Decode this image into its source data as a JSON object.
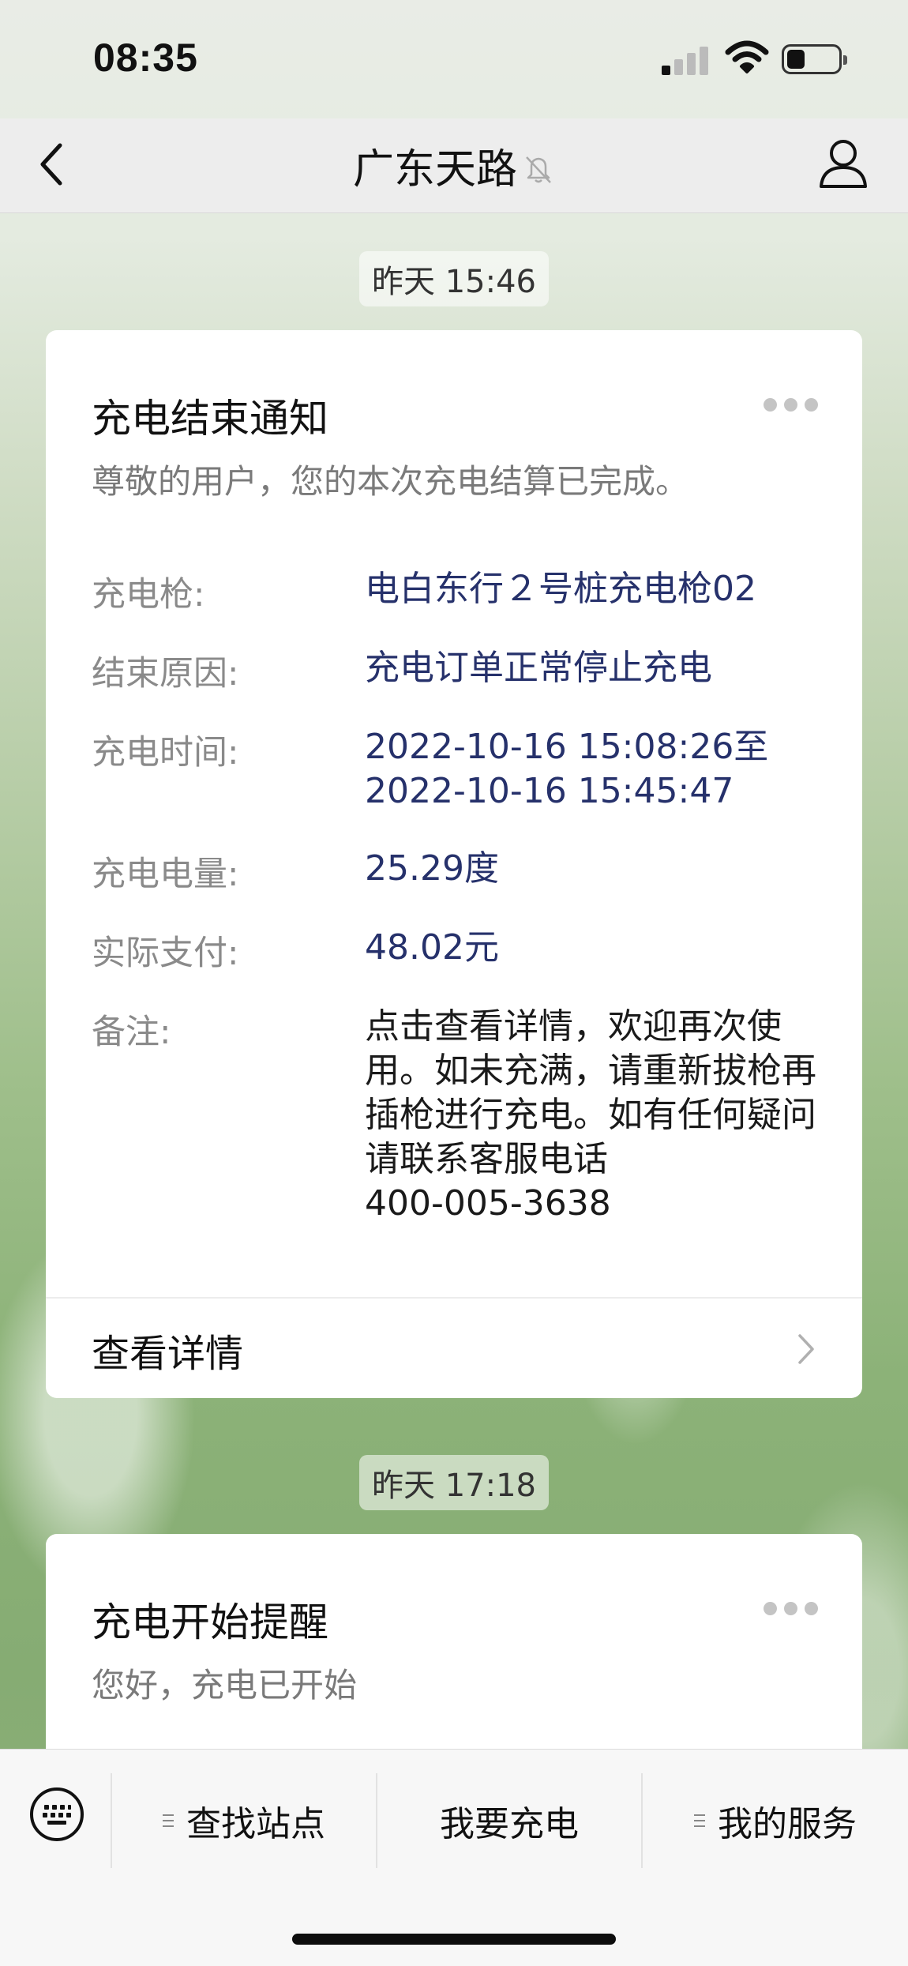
{
  "status_bar": {
    "time": "08:35"
  },
  "nav": {
    "title": "广东天路"
  },
  "messages": [
    {
      "timestamp": "昨天 15:46",
      "title": "充电结束通知",
      "subtitle": "尊敬的用户，您的本次充电结算已完成。",
      "rows": [
        {
          "label": "充电枪:",
          "value": "电白东行２号桩充电枪02"
        },
        {
          "label": "结束原因:",
          "value": "充电订单正常停止充电"
        },
        {
          "label": "充电时间:",
          "value_line1": "2022-10-16 15:08:26至",
          "value_line2": "2022-10-16 15:45:47"
        },
        {
          "label": "充电电量:",
          "value": "25.29度"
        },
        {
          "label": "实际支付:",
          "value": "48.02元"
        },
        {
          "label": "备注:",
          "value_lines": [
            "点击查看详情，欢迎再次使",
            "用。如未充满，请重新拔枪再",
            "插枪进行充电。如有任何疑问",
            "请联系客服电话",
            "400-005-3638"
          ]
        }
      ],
      "detail_link": "查看详情"
    },
    {
      "timestamp": "昨天 17:18",
      "title": "充电开始提醒",
      "subtitle": "您好，充电已开始"
    }
  ],
  "menu": {
    "items": [
      {
        "label": "查找站点",
        "has_submenu": true
      },
      {
        "label": "我要充电",
        "has_submenu": false
      },
      {
        "label": "我的服务",
        "has_submenu": true
      }
    ]
  },
  "colors": {
    "value_text": "#26316b",
    "label_text": "#8a8a8a",
    "card_bg": "#ffffff",
    "nav_bg": "#ededed"
  }
}
